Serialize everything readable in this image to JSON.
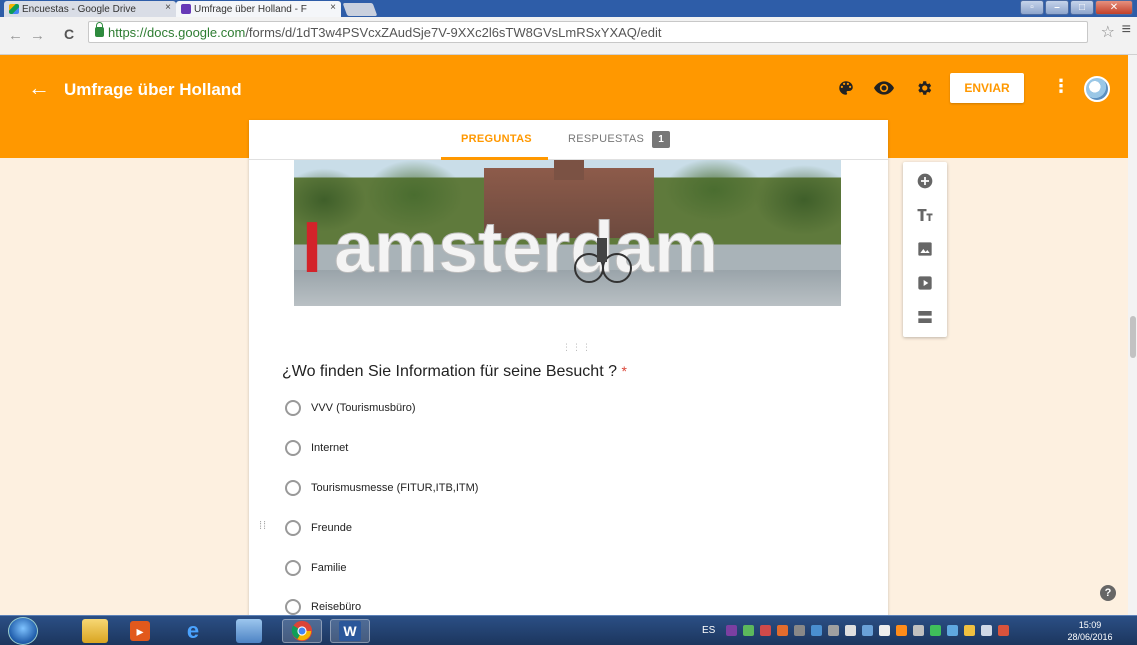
{
  "browser": {
    "tabs": [
      {
        "label": "Encuestas - Google Drive",
        "close": "×"
      },
      {
        "label": "Umfrage über Holland - F",
        "close": "×"
      }
    ],
    "url_scheme": "https://",
    "url_host": "docs.google.com",
    "url_path": "/forms/d/1dT3w4PSVcxZAudSje7V-9XXc2l6sTW8GVsLmRSxYXAQ/edit"
  },
  "header": {
    "title": "Umfrage über Holland",
    "send_label": "ENVIAR",
    "accent_color": "#ff9800"
  },
  "form_tabs": {
    "questions_label": "PREGUNTAS",
    "responses_label": "RESPUESTAS",
    "responses_count": "1"
  },
  "hero_image": {
    "sign_text": "Iamsterdam"
  },
  "question": {
    "title": "¿Wo finden Sie Information für seine Besucht  ?",
    "required_mark": "*",
    "options": [
      "VVV (Tourismusbüro)",
      "Internet",
      "Tourismusmesse (FITUR,ITB,ITM)",
      "Freunde",
      "Familie",
      "Reisebüro"
    ]
  },
  "help_label": "?",
  "taskbar": {
    "language": "ES",
    "time": "15:09",
    "date": "28/06/2016"
  }
}
